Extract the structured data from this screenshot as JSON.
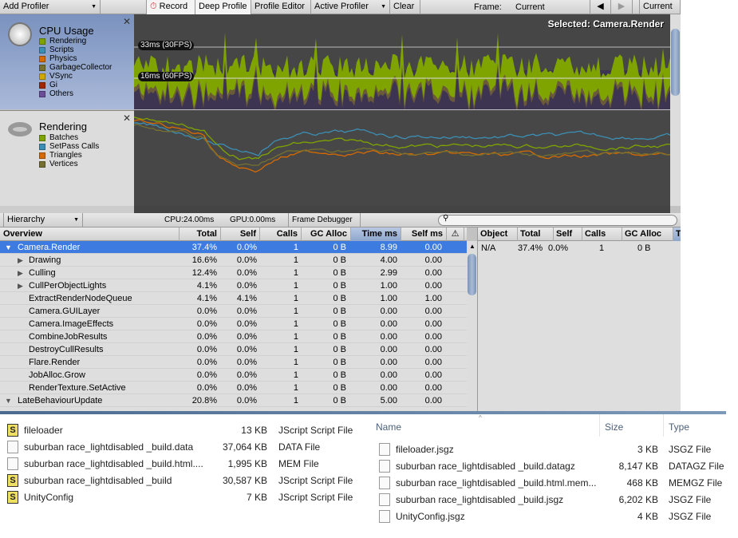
{
  "toolbar": {
    "add_profiler": "Add Profiler",
    "record": "Record",
    "deep_profile": "Deep Profile",
    "profile_editor": "Profile Editor",
    "active_profiler": "Active Profiler",
    "clear": "Clear",
    "frame_label": "Frame:",
    "frame_value": "Current",
    "current": "Current"
  },
  "cpu": {
    "title": "CPU Usage",
    "selected": "Selected: Camera.Render",
    "fps30": "33ms (30FPS)",
    "fps60": "16ms (60FPS)",
    "legend": [
      {
        "label": "Rendering",
        "color": "#7fa400"
      },
      {
        "label": "Scripts",
        "color": "#3c8fb4"
      },
      {
        "label": "Physics",
        "color": "#d66a00"
      },
      {
        "label": "GarbageCollector",
        "color": "#757030"
      },
      {
        "label": "VSync",
        "color": "#d0a800"
      },
      {
        "label": "Gi",
        "color": "#a02800"
      },
      {
        "label": "Others",
        "color": "#6a4e9a"
      }
    ]
  },
  "rendering": {
    "title": "Rendering",
    "legend": [
      {
        "label": "Batches",
        "color": "#7fa400"
      },
      {
        "label": "SetPass Calls",
        "color": "#3c8fb4"
      },
      {
        "label": "Triangles",
        "color": "#d66a00"
      },
      {
        "label": "Vertices",
        "color": "#757030"
      }
    ]
  },
  "hierarchy": {
    "mode": "Hierarchy",
    "cpu": "CPU:24.00ms",
    "gpu": "GPU:0.00ms",
    "frame_debugger": "Frame Debugger",
    "columns": [
      "Overview",
      "Total",
      "Self",
      "Calls",
      "GC Alloc",
      "Time ms",
      "Self ms"
    ],
    "rows": [
      {
        "name": "Camera.Render",
        "total": "37.4%",
        "self": "0.0%",
        "calls": "1",
        "gc": "0 B",
        "time": "8.99",
        "selfms": "0.00",
        "level": 0,
        "expander": "open",
        "selected": true
      },
      {
        "name": "Drawing",
        "total": "16.6%",
        "self": "0.0%",
        "calls": "1",
        "gc": "0 B",
        "time": "4.00",
        "selfms": "0.00",
        "level": 1,
        "expander": "closed"
      },
      {
        "name": "Culling",
        "total": "12.4%",
        "self": "0.0%",
        "calls": "1",
        "gc": "0 B",
        "time": "2.99",
        "selfms": "0.00",
        "level": 1,
        "expander": "closed"
      },
      {
        "name": "CullPerObjectLights",
        "total": "4.1%",
        "self": "0.0%",
        "calls": "1",
        "gc": "0 B",
        "time": "1.00",
        "selfms": "0.00",
        "level": 1,
        "expander": "closed"
      },
      {
        "name": "ExtractRenderNodeQueue",
        "total": "4.1%",
        "self": "4.1%",
        "calls": "1",
        "gc": "0 B",
        "time": "1.00",
        "selfms": "1.00",
        "level": 1,
        "expander": ""
      },
      {
        "name": "Camera.GUILayer",
        "total": "0.0%",
        "self": "0.0%",
        "calls": "1",
        "gc": "0 B",
        "time": "0.00",
        "selfms": "0.00",
        "level": 1,
        "expander": ""
      },
      {
        "name": "Camera.ImageEffects",
        "total": "0.0%",
        "self": "0.0%",
        "calls": "1",
        "gc": "0 B",
        "time": "0.00",
        "selfms": "0.00",
        "level": 1,
        "expander": ""
      },
      {
        "name": "CombineJobResults",
        "total": "0.0%",
        "self": "0.0%",
        "calls": "1",
        "gc": "0 B",
        "time": "0.00",
        "selfms": "0.00",
        "level": 1,
        "expander": ""
      },
      {
        "name": "DestroyCullResults",
        "total": "0.0%",
        "self": "0.0%",
        "calls": "1",
        "gc": "0 B",
        "time": "0.00",
        "selfms": "0.00",
        "level": 1,
        "expander": ""
      },
      {
        "name": "Flare.Render",
        "total": "0.0%",
        "self": "0.0%",
        "calls": "1",
        "gc": "0 B",
        "time": "0.00",
        "selfms": "0.00",
        "level": 1,
        "expander": ""
      },
      {
        "name": "JobAlloc.Grow",
        "total": "0.0%",
        "self": "0.0%",
        "calls": "1",
        "gc": "0 B",
        "time": "0.00",
        "selfms": "0.00",
        "level": 1,
        "expander": ""
      },
      {
        "name": "RenderTexture.SetActive",
        "total": "0.0%",
        "self": "0.0%",
        "calls": "1",
        "gc": "0 B",
        "time": "0.00",
        "selfms": "0.00",
        "level": 1,
        "expander": ""
      },
      {
        "name": "LateBehaviourUpdate",
        "total": "20.8%",
        "self": "0.0%",
        "calls": "1",
        "gc": "0 B",
        "time": "5.00",
        "selfms": "0.00",
        "level": 0,
        "expander": "open"
      }
    ]
  },
  "details": {
    "columns": [
      "Object",
      "Total",
      "Self",
      "Calls",
      "GC Alloc",
      "Time"
    ],
    "rows": [
      {
        "object": "N/A",
        "total": "37.4%",
        "self": "0.0%",
        "calls": "1",
        "gc": "0 B"
      }
    ]
  },
  "explorer_left": {
    "files": [
      {
        "name": "fileloader",
        "size": "13 KB",
        "type": "JScript Script File",
        "icon": "jscript-icon"
      },
      {
        "name": "suburban race_lightdisabled _build.data",
        "size": "37,064 KB",
        "type": "DATA File",
        "icon": "file-icon"
      },
      {
        "name": "suburban race_lightdisabled _build.html....",
        "size": "1,995 KB",
        "type": "MEM File",
        "icon": "file-icon"
      },
      {
        "name": "suburban race_lightdisabled _build",
        "size": "30,587 KB",
        "type": "JScript Script File",
        "icon": "jscript-icon"
      },
      {
        "name": "UnityConfig",
        "size": "7 KB",
        "type": "JScript Script File",
        "icon": "jscript-icon"
      }
    ]
  },
  "explorer_right": {
    "columns": [
      "Name",
      "Size",
      "Type"
    ],
    "files": [
      {
        "name": "fileloader.jsgz",
        "size": "3 KB",
        "type": "JSGZ File",
        "icon": "file-icon"
      },
      {
        "name": "suburban race_lightdisabled _build.datagz",
        "size": "8,147 KB",
        "type": "DATAGZ File",
        "icon": "file-icon"
      },
      {
        "name": "suburban race_lightdisabled _build.html.mem...",
        "size": "468 KB",
        "type": "MEMGZ File",
        "icon": "file-icon"
      },
      {
        "name": "suburban race_lightdisabled _build.jsgz",
        "size": "6,202 KB",
        "type": "JSGZ File",
        "icon": "file-icon"
      },
      {
        "name": "UnityConfig.jsgz",
        "size": "4 KB",
        "type": "JSGZ File",
        "icon": "file-icon"
      }
    ]
  }
}
